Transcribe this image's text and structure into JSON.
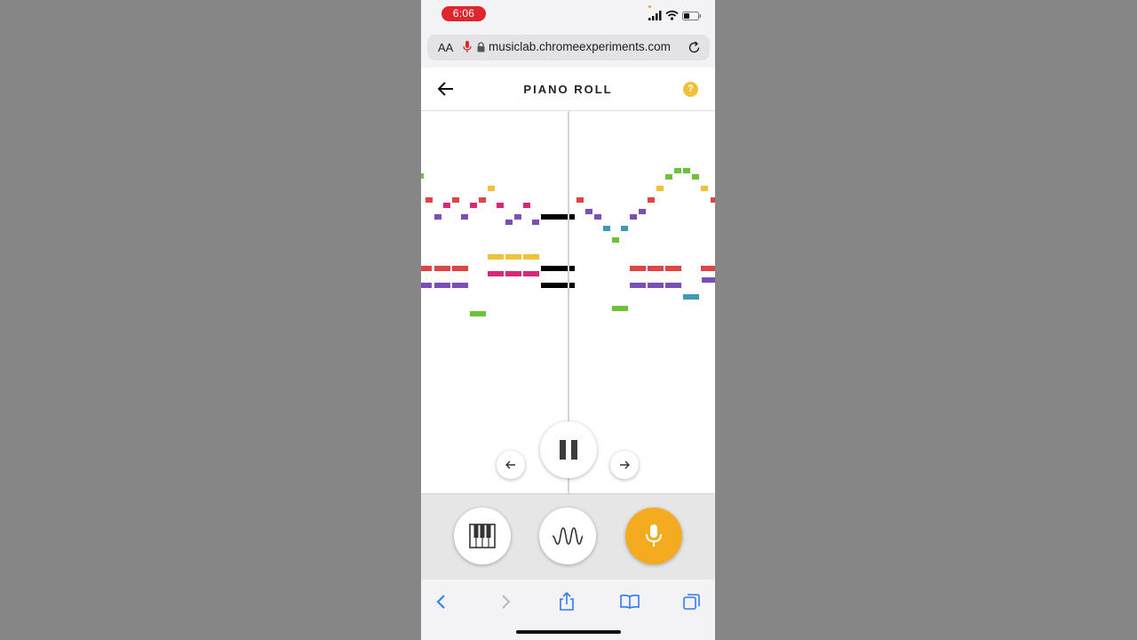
{
  "status": {
    "time": "6:06"
  },
  "browser": {
    "text_size_label": "AA",
    "url": "musiclab.chromeexperiments.com"
  },
  "app": {
    "title": "PIANO ROLL",
    "help_label": "?"
  },
  "colors": {
    "accent": "#f5ab1f",
    "red": "#e04545",
    "magenta": "#d6297a",
    "purple": "#7b4fb5",
    "blue": "#3f9ab5",
    "green": "#6dc13b",
    "yellow": "#f2c13a",
    "black": "#000000"
  },
  "icons": {
    "status": [
      "signal-icon",
      "wifi-icon",
      "battery-icon"
    ],
    "toolbar": [
      "back-icon",
      "help-icon"
    ],
    "player": [
      "previous-icon",
      "pause-icon",
      "next-icon"
    ],
    "instruments": [
      "piano-icon",
      "wave-icon",
      "microphone-icon"
    ],
    "safari": [
      "safari-back-icon",
      "safari-forward-icon",
      "share-icon",
      "bookmarks-icon",
      "tabs-icon"
    ]
  }
}
